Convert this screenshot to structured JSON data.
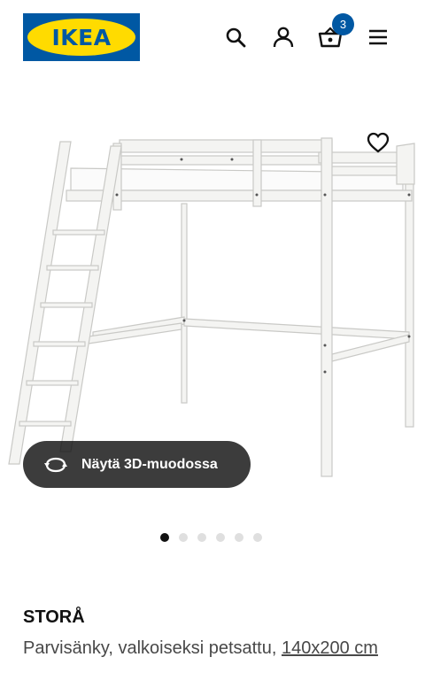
{
  "header": {
    "logo_text": "IKEA",
    "cart_count": "3",
    "icons": [
      "search-icon",
      "account-icon",
      "cart-icon",
      "menu-icon"
    ],
    "brand_blue": "#0058a3",
    "brand_yellow": "#ffdb00"
  },
  "gallery": {
    "view_3d_label": "Näytä 3D-muodossa",
    "slide_count": 6,
    "active_slide": 1
  },
  "product": {
    "name": "STORÅ",
    "description": "Parvisänky, valkoiseksi petsattu, ",
    "size_link": "140x200 cm"
  }
}
